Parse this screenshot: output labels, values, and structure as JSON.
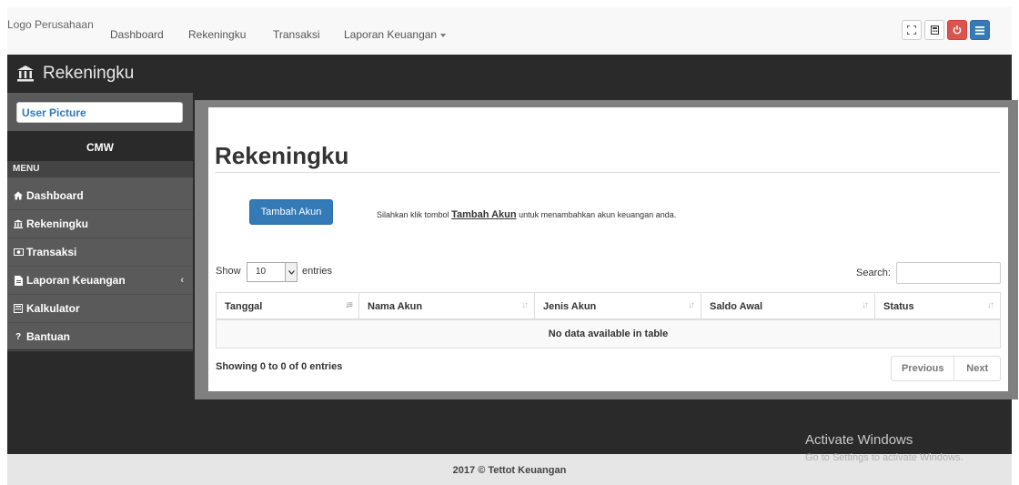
{
  "navbar": {
    "brand": "Logo Perusahaan",
    "links": [
      {
        "label": "Dashboard"
      },
      {
        "label": "Rekeningku"
      },
      {
        "label": "Transaksi"
      },
      {
        "label": "Laporan Keuangan"
      }
    ],
    "buttons": [
      "fullscreen-icon",
      "calculator-icon",
      "power-icon",
      "menu-icon"
    ]
  },
  "header": {
    "title": "Rekeningku",
    "icon": "bank-icon"
  },
  "sidebar": {
    "user_picture": "User Picture",
    "user_name": "CMW",
    "menu_label": "MENU",
    "items": [
      {
        "label": "Dashboard",
        "icon": "home-icon"
      },
      {
        "label": "Rekeningku",
        "icon": "bank-icon"
      },
      {
        "label": "Transaksi",
        "icon": "money-icon"
      },
      {
        "label": "Laporan Keuangan",
        "icon": "file-icon"
      },
      {
        "label": "Kalkulator",
        "icon": "calculator-icon"
      },
      {
        "label": "Bantuan",
        "icon": "question-icon"
      }
    ]
  },
  "main": {
    "title": "Rekeningku",
    "add_button": "Tambah Akun",
    "hint_prefix": "Silahkan klik tombol",
    "hint_link": "Tambah Akun",
    "hint_suffix": "untuk menambahkan akun keuangan anda.",
    "show_label": "Show",
    "page_size": "10",
    "entries_label": "entries",
    "search_label": "Search:",
    "search_value": "",
    "columns": [
      "Tanggal",
      "Nama Akun",
      "Jenis Akun",
      "Saldo Awal",
      "Status"
    ],
    "empty_message": "No data available in table",
    "info": "Showing 0 to 0 of 0 entries",
    "prev_label": "Previous",
    "next_label": "Next"
  },
  "footer": {
    "text": "2017 © Tettot Keuangan"
  },
  "watermark": {
    "title": "Activate Windows",
    "subtitle": "Go to Settings to activate Windows."
  },
  "colors": {
    "primary": "#337ab7",
    "danger": "#d9534f",
    "dark": "#2a2a2a",
    "sidebar": "#5a5a5a"
  }
}
